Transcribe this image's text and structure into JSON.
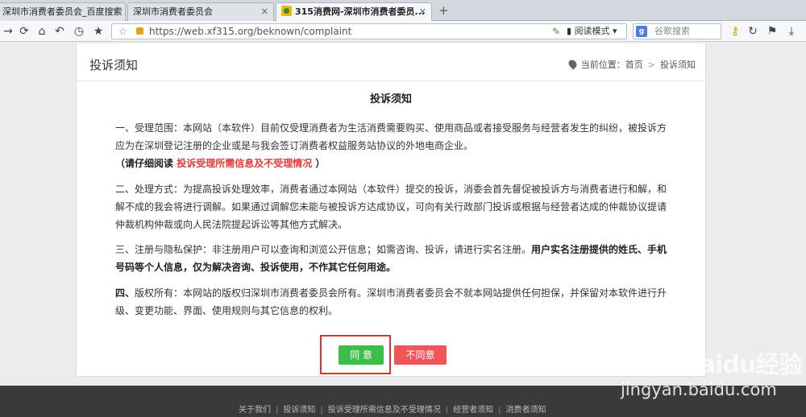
{
  "browser": {
    "tabs": [
      {
        "title": "深圳市消费者委员会_百度搜索",
        "active": false
      },
      {
        "title": "深圳市消费者委员会",
        "active": false
      },
      {
        "title": "315消费网-深圳市消费者委员...",
        "active": true
      }
    ],
    "new_tab": "+",
    "url": "https://web.xf315.org/beknown/complaint",
    "reading_mode": "阅读模式",
    "search_placeholder": "谷歌搜索",
    "search_engine_letter": "g"
  },
  "page": {
    "title": "投诉须知",
    "breadcrumb": {
      "prefix": "当前位置：",
      "home": "首页",
      "separator": ">",
      "current": "投诉须知"
    },
    "notice_title": "投诉须知",
    "para1": "一、受理范围：本网站（本软件）目前仅受理消费者为生活消费需要购买、使用商品或者接受服务与经营者发生的纠纷，被投诉方应为在深圳登记注册的企业或是与我会签订消费者权益服务站协议的外地电商企业。",
    "para1_note_open": "（请仔细阅读 ",
    "para1_link": "投诉受理所需信息及不受理情况",
    "para1_note_close": " ）",
    "para2": "二、处理方式：为提高投诉处理效率，消费者通过本网站（本软件）提交的投诉，消委会首先督促被投诉方与消费者进行和解，和解不成的我会将进行调解。如果通过调解您未能与被投诉方达成协议，可向有关行政部门投诉或根据与经营者达成的仲裁协议提请仲裁机构仲裁或向人民法院提起诉讼等其他方式解决。",
    "para3_normal": "三、注册与隐私保护：非注册用户可以查询和浏览公开信息；如需咨询、投诉，请进行实名注册。",
    "para3_bold": "用户实名注册提供的姓氏、手机号码等个人信息，仅为解决咨询、投诉使用，不作其它任何用途。",
    "para4_bold": "四、",
    "para4": "版权所有：本网站的版权归深圳市消费者委员会所有。深圳市消费者委员会不就本网站提供任何担保，并保留对本软件进行升级、变更功能、界面、使用规则与其它信息的权利。",
    "agree_label": "同 意",
    "disagree_label": "不同意"
  },
  "footer": {
    "links": [
      "关于我们",
      "投诉须知",
      "投诉受理所需信息及不受理情况",
      "经营者须知",
      "消费者须知"
    ]
  },
  "watermark": {
    "brand": "Baidu经验",
    "url": "jingyan.baidu.com"
  }
}
